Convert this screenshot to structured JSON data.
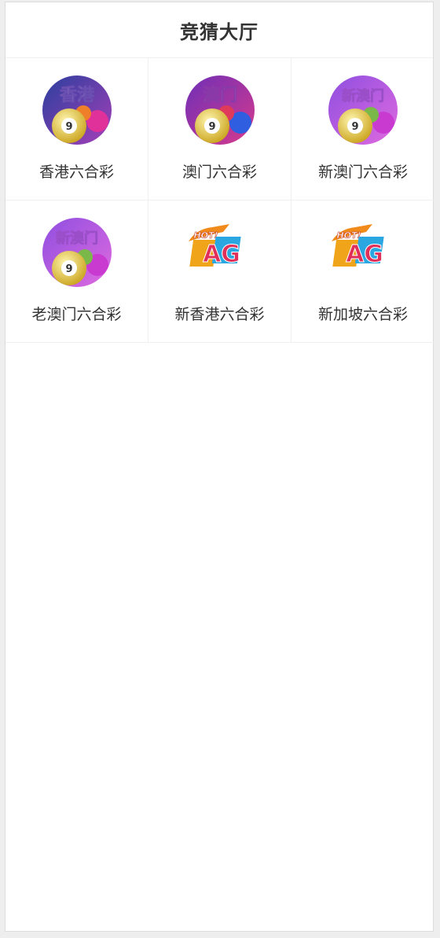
{
  "header": {
    "title": "竞猜大厅"
  },
  "games": [
    {
      "label": "香港六合彩",
      "icon": "hongkong-lottery-icon",
      "badge": "香港",
      "bg_from": "#2a3f9e",
      "bg_to": "#a63fb8"
    },
    {
      "label": "澳门六合彩",
      "icon": "macau-lottery-icon",
      "badge": "澳门",
      "bg_from": "#6d2fb8",
      "bg_to": "#d83a8c"
    },
    {
      "label": "新澳门六合彩",
      "icon": "new-macau-lottery-icon",
      "badge": "新澳门",
      "bg_from": "#8e4fe0",
      "bg_to": "#e06adf"
    },
    {
      "label": "老澳门六合彩",
      "icon": "old-macau-lottery-icon",
      "badge": "新澳门",
      "bg_from": "#8e4fe0",
      "bg_to": "#e06adf"
    },
    {
      "label": "新香港六合彩",
      "icon": "ag-hot-icon",
      "badge": "AG"
    },
    {
      "label": "新加坡六合彩",
      "icon": "ag-hot-icon",
      "badge": "AG"
    }
  ],
  "ag_badge": {
    "hot_text": "HOT!",
    "brand_text": "AG"
  }
}
